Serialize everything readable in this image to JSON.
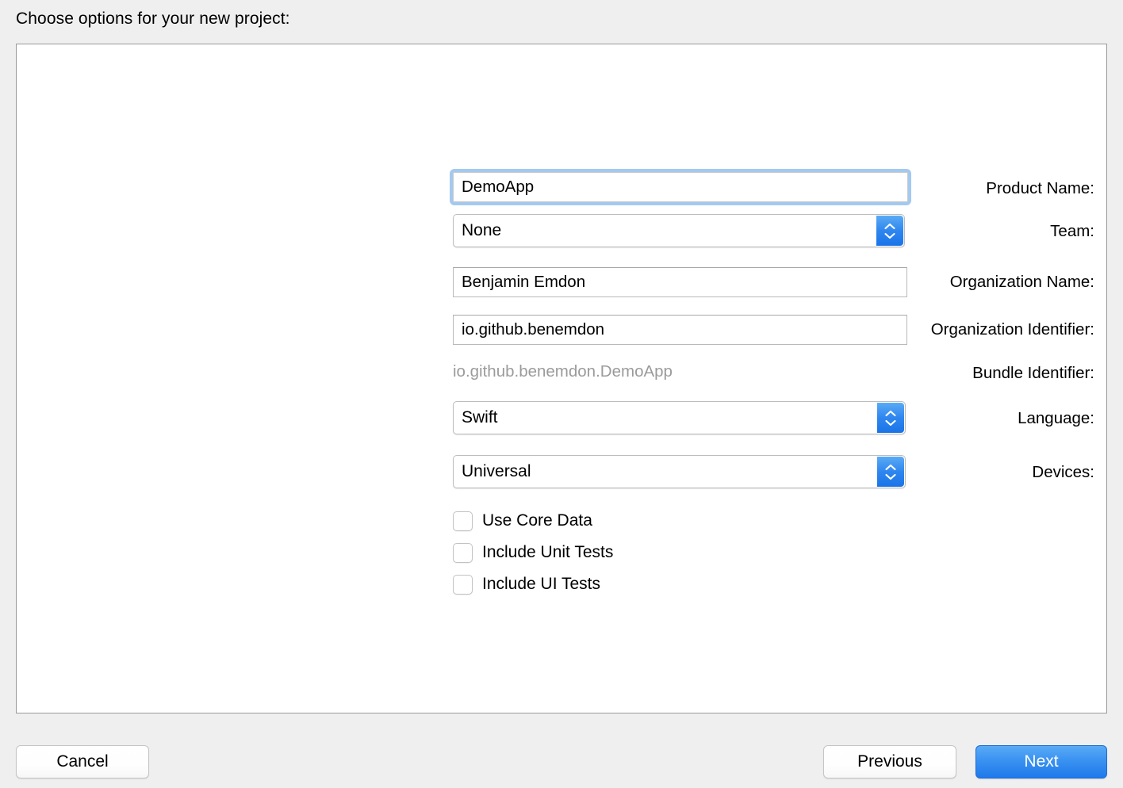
{
  "dialog": {
    "title": "Choose options for your new project:"
  },
  "form": {
    "fields": [
      {
        "label": "Product Name:",
        "type": "text",
        "value": "DemoApp",
        "focused": true
      },
      {
        "label": "Team:",
        "type": "popup",
        "value": "None"
      },
      {
        "label": "Organization Name:",
        "type": "text",
        "value": "Benjamin Emdon",
        "focused": false
      },
      {
        "label": "Organization Identifier:",
        "type": "text",
        "value": "io.github.benemdon",
        "focused": false
      },
      {
        "label": "Bundle Identifier:",
        "type": "static",
        "value": "io.github.benemdon.DemoApp"
      },
      {
        "label": "Language:",
        "type": "popup",
        "value": "Swift"
      },
      {
        "label": "Devices:",
        "type": "popup",
        "value": "Universal"
      }
    ],
    "checkboxes": [
      {
        "label": "Use Core Data",
        "checked": false
      },
      {
        "label": "Include Unit Tests",
        "checked": false
      },
      {
        "label": "Include UI Tests",
        "checked": false
      }
    ]
  },
  "footer": {
    "cancel_label": "Cancel",
    "previous_label": "Previous",
    "next_label": "Next"
  },
  "colors": {
    "accent_blue": "#1f79ea",
    "stepper_blue": "#2f86ef",
    "focus_ring": "#a4c9ef",
    "window_background": "#efefef",
    "panel_background": "#ffffff",
    "panel_border": "#9a9a9a",
    "disabled_text": "#9b9b9b"
  }
}
